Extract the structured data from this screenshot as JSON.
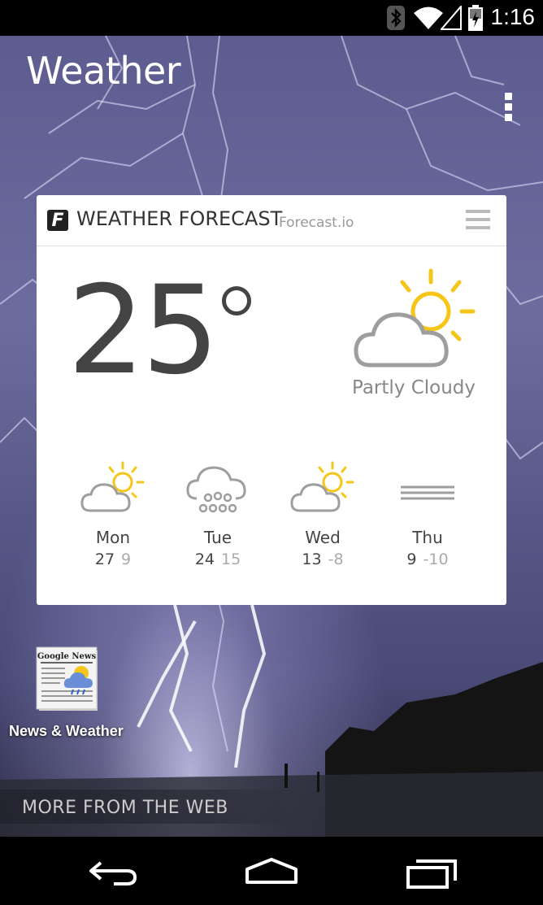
{
  "status_bar": {
    "time": "1:16",
    "icons": [
      "bluetooth-icon",
      "wifi-icon",
      "cell-signal-icon",
      "battery-charging-icon"
    ]
  },
  "app": {
    "title": "Weather",
    "menu_icon": "overflow-menu-icon"
  },
  "widget": {
    "title": "WEATHER FORECAST",
    "source": "Forecast.io",
    "logo_letter": "F",
    "current": {
      "temperature": "25",
      "condition": "Partly Cloudy",
      "icon": "partly-cloudy-icon"
    },
    "forecast": [
      {
        "day": "Mon",
        "high": "27",
        "low": "9",
        "icon": "partly-cloudy-icon"
      },
      {
        "day": "Tue",
        "high": "24",
        "low": "15",
        "icon": "snow-cloud-icon"
      },
      {
        "day": "Wed",
        "high": "13",
        "low": "-8",
        "icon": "partly-cloudy-icon"
      },
      {
        "day": "Thu",
        "high": "9",
        "low": "-10",
        "icon": "fog-icon"
      }
    ]
  },
  "shortcut": {
    "label": "News & Weather",
    "icon_text": "Google News"
  },
  "more_from_web": "MORE FROM THE WEB",
  "nav_bar": {
    "buttons": [
      "back-icon",
      "home-icon",
      "recent-apps-icon"
    ]
  },
  "colors": {
    "sun": "#f5c518",
    "cloud": "#9e9e9e",
    "wallpaper": "#6d6c9f"
  }
}
